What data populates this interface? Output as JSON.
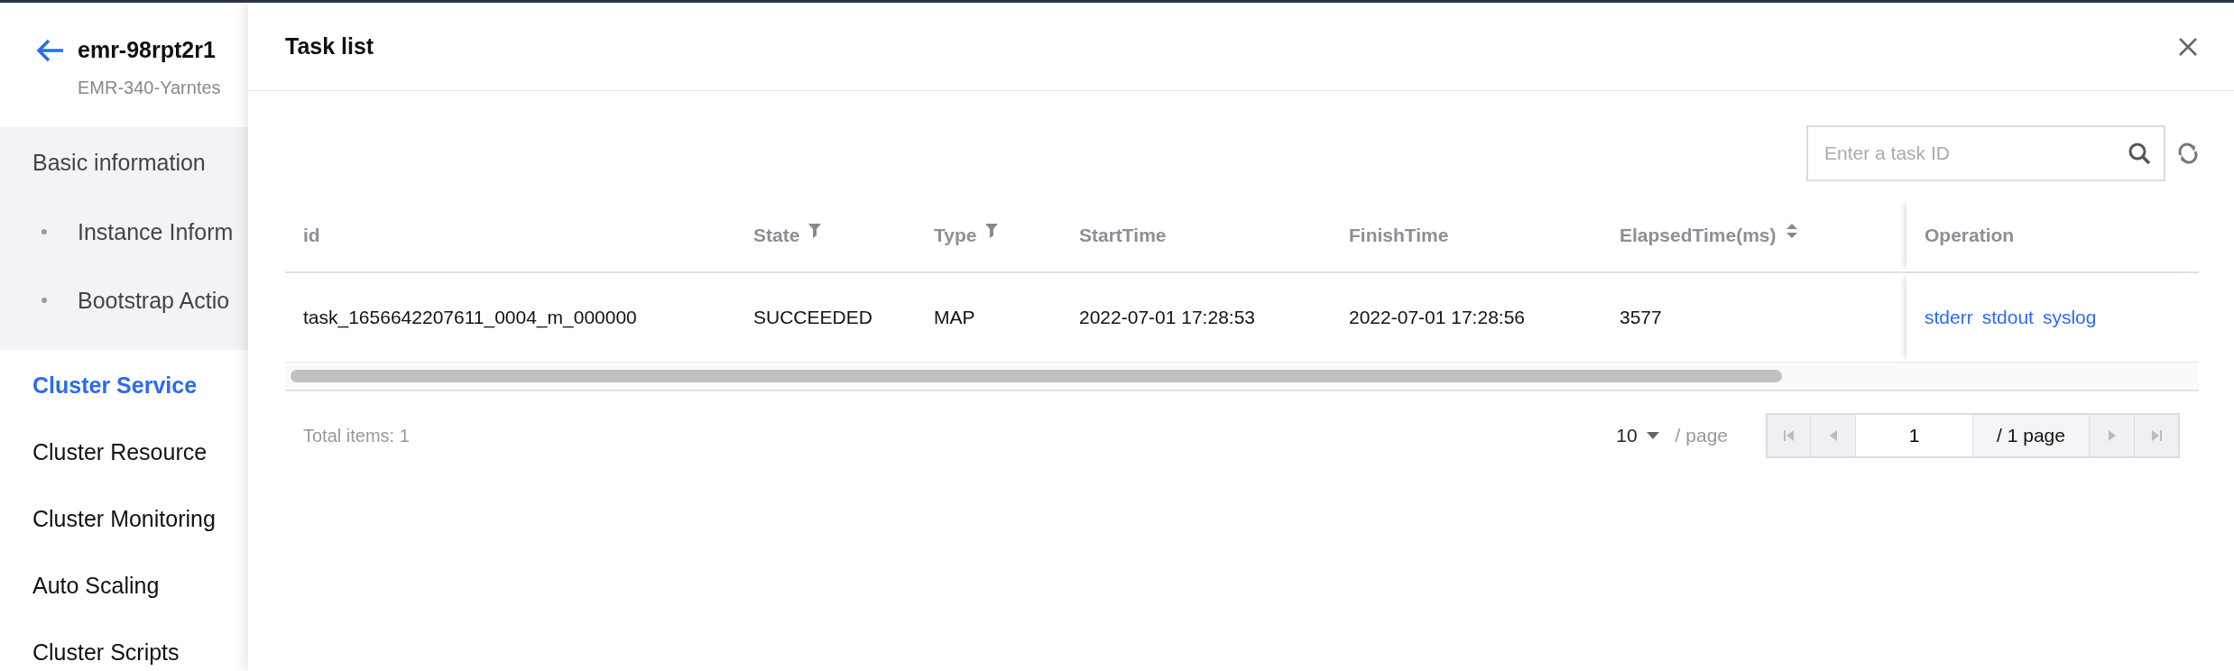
{
  "sidebar": {
    "title": "emr-98rpt2r1",
    "subtitle": "EMR-340-Yarntes",
    "groups": [
      {
        "label": "Basic information",
        "children": [
          {
            "label": "Instance Inform",
            "selected": false
          },
          {
            "label": "Bootstrap Actio",
            "selected": false
          }
        ]
      }
    ],
    "items": [
      {
        "label": "Cluster Service",
        "selected": true
      },
      {
        "label": "Cluster Resource",
        "selected": false
      },
      {
        "label": "Cluster Monitoring",
        "selected": false
      },
      {
        "label": "Auto Scaling",
        "selected": false
      },
      {
        "label": "Cluster Scripts",
        "selected": false
      }
    ]
  },
  "panel": {
    "title": "Task list",
    "search": {
      "placeholder": "Enter a task ID"
    },
    "table": {
      "columns": [
        {
          "label": "id",
          "filter": false,
          "sort": false
        },
        {
          "label": "State",
          "filter": true,
          "sort": false
        },
        {
          "label": "Type",
          "filter": true,
          "sort": false
        },
        {
          "label": "StartTime",
          "filter": false,
          "sort": false
        },
        {
          "label": "FinishTime",
          "filter": false,
          "sort": false
        },
        {
          "label": "ElapsedTime(ms)",
          "filter": false,
          "sort": true
        },
        {
          "label": "Operation",
          "filter": false,
          "sort": false
        }
      ],
      "rows": [
        {
          "cells": [
            "task_1656642207611_0004_m_000000",
            "SUCCEEDED",
            "MAP",
            "2022-07-01 17:28:53",
            "2022-07-01 17:28:56",
            "3577"
          ],
          "links": [
            "stderr",
            "stdout",
            "syslog"
          ]
        }
      ]
    },
    "footer": {
      "total": "Total items:  1",
      "page_size": "10",
      "per_page": "/ page",
      "page": "1",
      "pages": "/ 1 page"
    }
  }
}
